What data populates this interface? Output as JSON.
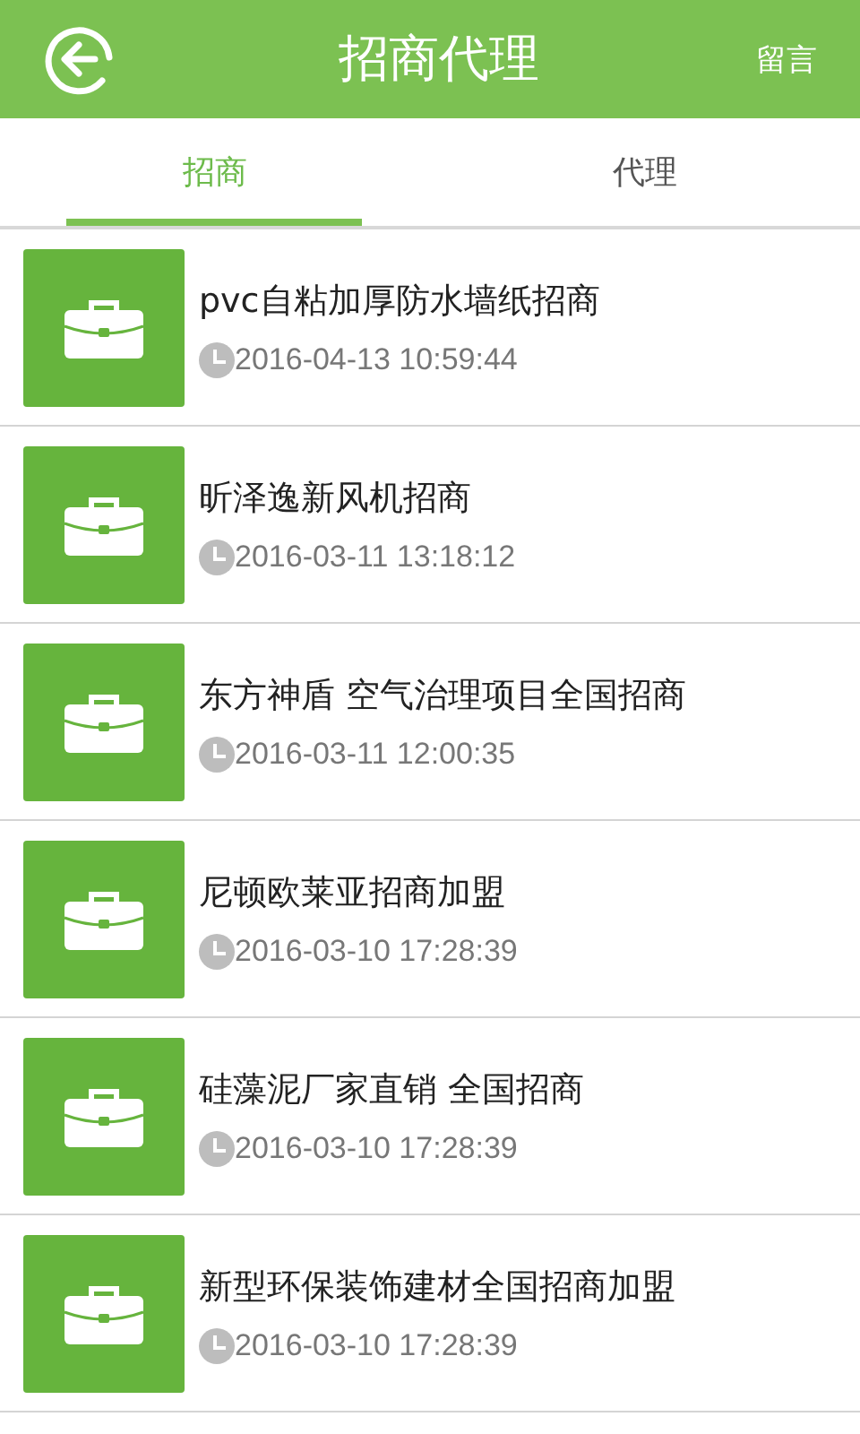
{
  "header": {
    "title": "招商代理",
    "action": "留言"
  },
  "tabs": [
    {
      "label": "招商",
      "selected": true
    },
    {
      "label": "代理",
      "selected": false
    }
  ],
  "items": [
    {
      "title": "pvc自粘加厚防水墙纸招商",
      "time": "2016-04-13 10:59:44"
    },
    {
      "title": "昕泽逸新风机招商",
      "time": "2016-03-11 13:18:12"
    },
    {
      "title": "东方神盾 空气治理项目全国招商",
      "time": "2016-03-11 12:00:35"
    },
    {
      "title": "尼顿欧莱亚招商加盟",
      "time": "2016-03-10 17:28:39"
    },
    {
      "title": "硅藻泥厂家直销 全国招商",
      "time": "2016-03-10 17:28:39"
    },
    {
      "title": "新型环保装饰建材全国招商加盟",
      "time": "2016-03-10 17:28:39"
    }
  ]
}
